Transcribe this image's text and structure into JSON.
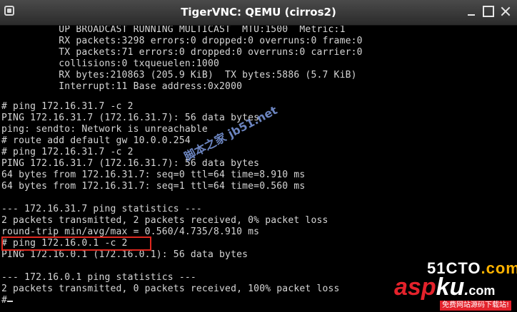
{
  "window": {
    "title": "TigerVNC: QEMU (cirros2)"
  },
  "terminal": {
    "lines": [
      "          UP BROADCAST RUNNING MULTICAST  MTU:1500  Metric:1",
      "          RX packets:3298 errors:0 dropped:0 overruns:0 frame:0",
      "          TX packets:71 errors:0 dropped:0 overruns:0 carrier:0",
      "          collisions:0 txqueuelen:1000",
      "          RX bytes:210863 (205.9 KiB)  TX bytes:5886 (5.7 KiB)",
      "          Interrupt:11 Base address:0x2000",
      "",
      "# ping 172.16.31.7 -c 2",
      "PING 172.16.31.7 (172.16.31.7): 56 data bytes",
      "ping: sendto: Network is unreachable",
      "# route add default gw 10.0.0.254",
      "# ping 172.16.31.7 -c 2",
      "PING 172.16.31.7 (172.16.31.7): 56 data bytes",
      "64 bytes from 172.16.31.7: seq=0 ttl=64 time=8.910 ms",
      "64 bytes from 172.16.31.7: seq=1 ttl=64 time=0.560 ms",
      "",
      "--- 172.16.31.7 ping statistics ---",
      "2 packets transmitted, 2 packets received, 0% packet loss",
      "round-trip min/avg/max = 0.560/4.735/8.910 ms",
      "# ping 172.16.0.1 -c 2",
      "PING 172.16.0.1 (172.16.0.1): 56 data bytes",
      "",
      "--- 172.16.0.1 ping statistics ---",
      "2 packets transmitted, 0 packets received, 100% packet loss",
      "#"
    ]
  },
  "watermarks": {
    "jb51": "脚本之家 jb51.net",
    "logo_51": "51CTO",
    "logo_com": ".com",
    "logo_asp": "asp",
    "logo_ku": "ku",
    "logo_dot": ".",
    "logo_com2": "com",
    "logo_sub": "免费网站源码下载站!"
  },
  "colors": {
    "terminal_text": "#d6d6d6",
    "highlight": "#e0281e",
    "titlebar": "#3a3a3a"
  }
}
